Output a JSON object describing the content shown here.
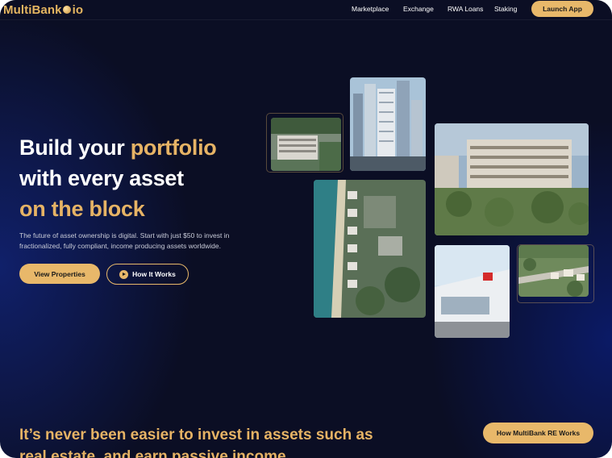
{
  "header": {
    "logo_text": "MultiBank",
    "logo_suffix": "io",
    "nav": [
      "Marketplace",
      "Exchange",
      "RWA Loans",
      "Staking"
    ],
    "launch_label": "Launch App"
  },
  "hero": {
    "line1_white": "Build your ",
    "line1_gold": "portfolio",
    "line2": "with every asset",
    "line3": "on the block",
    "subtitle": "The future of asset ownership is digital. Start with just $50 to invest in fractionalized, fully compliant, income producing assets worldwide.",
    "primary_label": "View Properties",
    "secondary_label": "How It Works"
  },
  "bottom": {
    "line1": "It’s never been easier to invest in assets such as",
    "line2": "real estate, and earn passive income",
    "how_label": "How MultiBank RE Works"
  },
  "colors": {
    "accent": "#e8b86a",
    "background": "#0b0e24",
    "gold_text": "#e6b365"
  },
  "icons": [
    "logo-coin-icon",
    "play-icon"
  ]
}
